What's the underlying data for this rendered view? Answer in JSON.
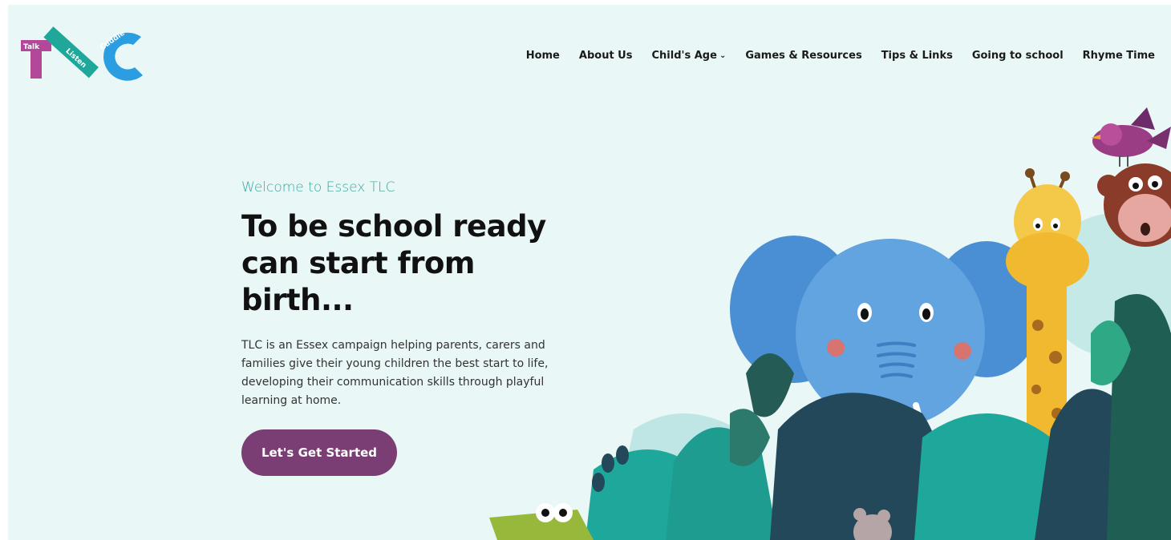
{
  "logo": {
    "words": [
      "Talk",
      "Listen",
      "Cuddle"
    ],
    "letters": "TLC"
  },
  "nav": {
    "items": [
      "Home",
      "About Us",
      "Child's Age",
      "Games & Resources",
      "Tips & Links",
      "Going to school",
      "Rhyme Time"
    ]
  },
  "hero": {
    "eyebrow": "Welcome to Essex TLC",
    "headline_line1": "To be school ready",
    "headline_line2": "can start from birth...",
    "intro": "TLC is an Essex campaign helping parents, carers and families give their young children the best start to life, developing their communication skills through playful learning at home.",
    "cta_label": "Let's Get Started"
  },
  "colors": {
    "background": "#e9f7f6",
    "accent_teal": "#3aa89e",
    "cta_purple": "#7a3e74",
    "logo_pink": "#b3489b",
    "logo_teal": "#1fa79a",
    "logo_blue": "#2a9ee0"
  },
  "icons": [
    "chevron-down-icon"
  ]
}
